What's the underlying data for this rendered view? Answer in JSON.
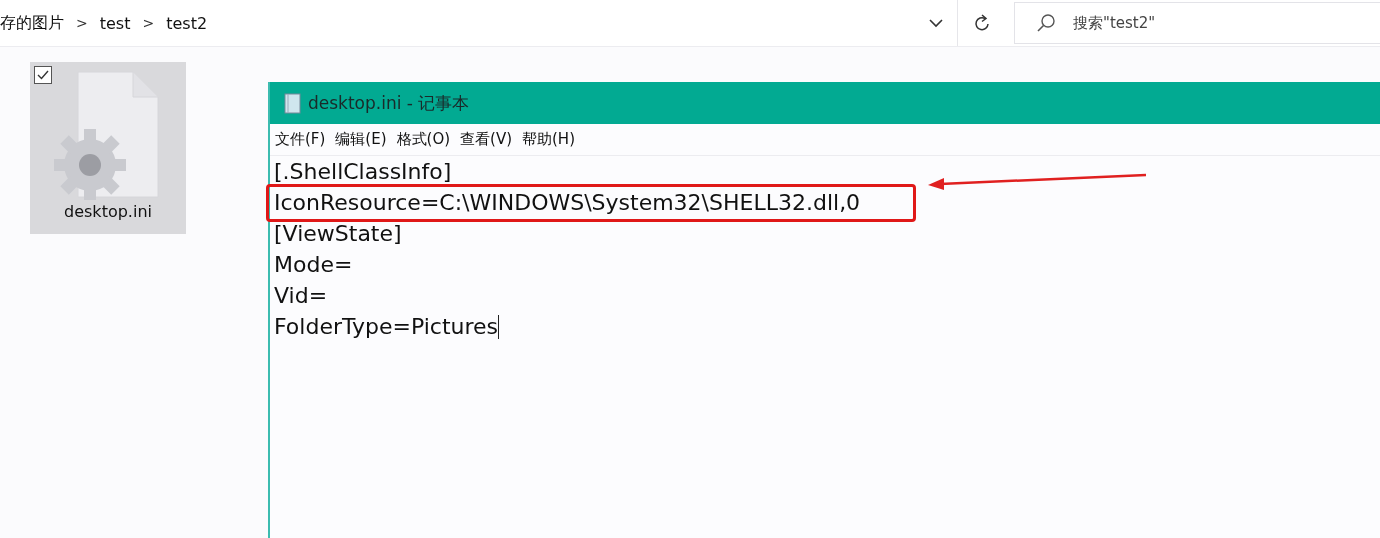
{
  "address_bar": {
    "breadcrumbs": [
      "存的图片",
      "test",
      "test2"
    ],
    "separator": ">"
  },
  "search": {
    "placeholder": "搜索\"test2\""
  },
  "files": [
    {
      "name": "desktop.ini",
      "checked": true,
      "selected": true
    }
  ],
  "notepad": {
    "title": "desktop.ini - 记事本",
    "menu": [
      "文件(F)",
      "编辑(E)",
      "格式(O)",
      "查看(V)",
      "帮助(H)"
    ],
    "lines": [
      {
        "text": "[.ShellClassInfo]",
        "annotated": false,
        "caret": false
      },
      {
        "text": "IconResource=C:\\WINDOWS\\System32\\SHELL32.dll,0",
        "annotated": true,
        "caret": false
      },
      {
        "text": "[ViewState]",
        "annotated": false,
        "caret": false
      },
      {
        "text": "Mode=",
        "annotated": false,
        "caret": false
      },
      {
        "text": "Vid=",
        "annotated": false,
        "caret": false
      },
      {
        "text": "FolderType=Pictures",
        "annotated": false,
        "caret": true
      }
    ]
  }
}
